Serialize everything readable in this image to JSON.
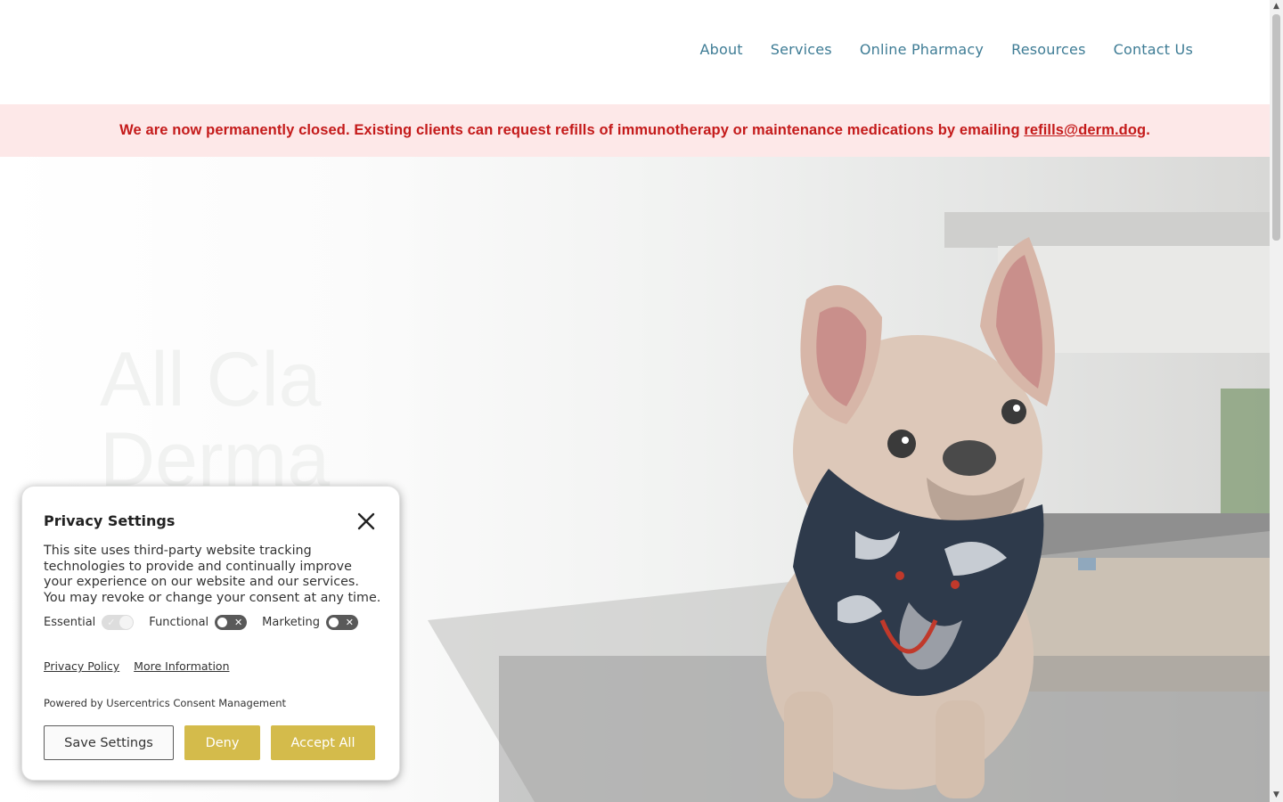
{
  "nav": {
    "items": [
      {
        "label": "About"
      },
      {
        "label": "Services"
      },
      {
        "label": "Online Pharmacy"
      },
      {
        "label": "Resources"
      },
      {
        "label": "Contact Us"
      }
    ]
  },
  "banner": {
    "text": "We are now permanently closed. Existing clients can request refills of immunotherapy or maintenance medications by emailing ",
    "email": "refills@derm.dog",
    "suffix": "."
  },
  "hero": {
    "line1": "All Cla",
    "line2": "Derma"
  },
  "privacy": {
    "title": "Privacy Settings",
    "body": "This site uses third-party website tracking technologies to provide and continually improve your experience on our website and our services. You may revoke or change your consent at any time.",
    "toggles": [
      {
        "label": "Essential",
        "state": "on-disabled"
      },
      {
        "label": "Functional",
        "state": "off"
      },
      {
        "label": "Marketing",
        "state": "off"
      }
    ],
    "links": {
      "privacy_policy": "Privacy Policy",
      "more_info": "More Information"
    },
    "powered_by": "Powered by Usercentrics Consent Management",
    "buttons": {
      "save": "Save Settings",
      "deny": "Deny",
      "accept": "Accept All"
    }
  },
  "colors": {
    "nav_text": "#3e7c95",
    "banner_bg": "#fde8e8",
    "banner_text": "#c41a1a",
    "accent_button": "#d4bb4b"
  }
}
